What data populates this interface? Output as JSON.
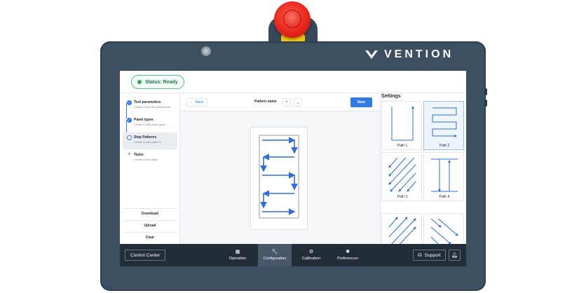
{
  "brand": {
    "name": "VENTION"
  },
  "status": {
    "label": "Status: Ready",
    "color": "#27ae60"
  },
  "steps": [
    {
      "title": "Tool parameters",
      "subtitle": "Create & edit tool parameters",
      "state": "done"
    },
    {
      "title": "Panel types",
      "subtitle": "Create & edit panel types",
      "state": "done"
    },
    {
      "title": "Step Patterns",
      "subtitle": "Create & edit patterns",
      "state": "current"
    },
    {
      "title": "Tasks",
      "subtitle": "Create & edit tasks",
      "state": "todo",
      "icon": "+"
    }
  ],
  "left_actions": {
    "download": "Download",
    "upload": "Upload",
    "clear": "Clear"
  },
  "toolbar": {
    "back": "Back",
    "pattern_name": "Pattern name",
    "add": "+",
    "dropdown": "⌄",
    "save": "Save"
  },
  "settings": {
    "title": "Settings",
    "paths": [
      {
        "label": "Path 1",
        "pattern": "vertical-loop"
      },
      {
        "label": "Path 2",
        "pattern": "serpentine-horizontal",
        "selected": true
      },
      {
        "label": "Path 3",
        "pattern": "diagonal-down"
      },
      {
        "label": "Path 4",
        "pattern": "vertical-pairs"
      },
      {
        "label": "",
        "pattern": "diagonal-up"
      },
      {
        "label": "",
        "pattern": "diagonal-down-right"
      }
    ]
  },
  "bottom_nav": {
    "control_center": "Control Center",
    "items": [
      {
        "label": "Operation",
        "icon": "grid-icon"
      },
      {
        "label": "Configuration",
        "icon": "wrench-icon",
        "active": true
      },
      {
        "label": "Calibration",
        "icon": "calibration-icon"
      },
      {
        "label": "Preferences",
        "icon": "gear-icon"
      }
    ],
    "support": "Support"
  },
  "colors": {
    "accent": "#2f7be8",
    "bezel": "#3d5061",
    "nav": "#232d38",
    "estop": "#e8261c"
  }
}
